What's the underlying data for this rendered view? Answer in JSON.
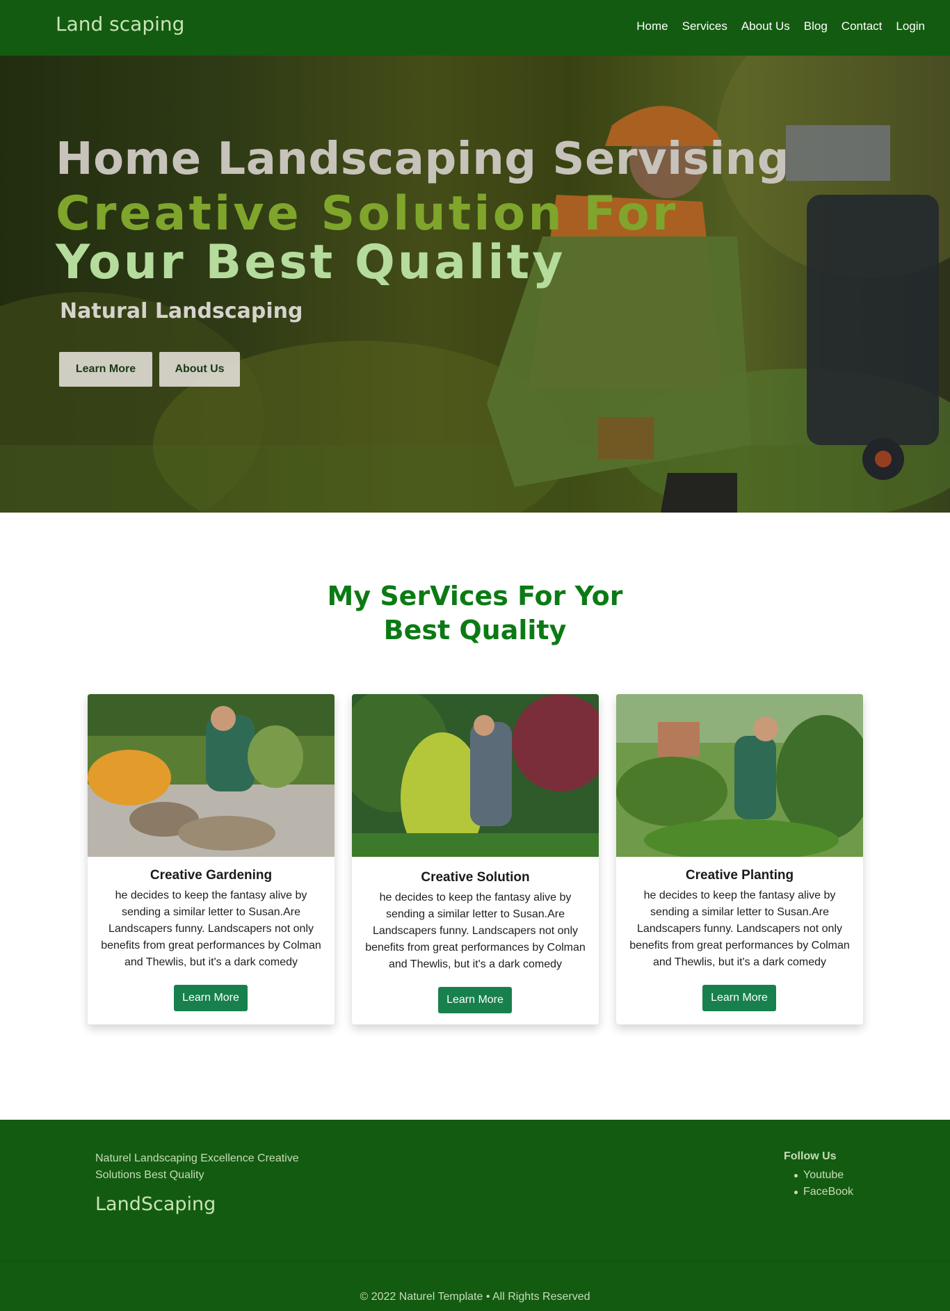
{
  "navbar": {
    "brand": "Land scaping",
    "links": [
      "Home",
      "Services",
      "About Us",
      "Blog",
      "Contact",
      "Login"
    ]
  },
  "hero": {
    "title": "Home Landscaping Servising",
    "line2": "Creative Solution For",
    "line3": "Your Best Quality",
    "subtitle": "Natural Landscaping",
    "learn_more": "Learn More",
    "about_us": "About Us"
  },
  "services": {
    "title_line1": "My SerVices For Yor",
    "title_line2": "Best Quality",
    "cards": [
      {
        "title": "Creative Gardening",
        "text": "he decides to keep the fantasy alive by sending a similar letter to Susan.Are Landscapers funny. Landscapers not only benefits from great performances by Colman and Thewlis, but it's a dark comedy",
        "button": "Learn More"
      },
      {
        "title": "Creative Solution",
        "text": "he decides to keep the fantasy alive by sending a similar letter to Susan.Are Landscapers funny. Landscapers not only benefits from great performances by Colman and Thewlis, but it's a dark comedy",
        "button": "Learn More"
      },
      {
        "title": "Creative Planting",
        "text": "he decides to keep the fantasy alive by sending a similar letter to Susan.Are Landscapers funny. Landscapers not only benefits from great performances by Colman and Thewlis, but it's a dark comedy",
        "button": "Learn More"
      }
    ]
  },
  "footer": {
    "tagline": "Naturel Landscaping Excellence Creative Solutions Best Quality",
    "brand": "LandScaping",
    "follow_title": "Follow Us",
    "follow_links": [
      "Youtube",
      "FaceBook"
    ],
    "copyright": "© 2022 Naturel Template • All Rights Reserved"
  },
  "colors": {
    "primary_green": "#135b11",
    "heading_green": "#0c7a14",
    "button_green": "#18804d"
  }
}
